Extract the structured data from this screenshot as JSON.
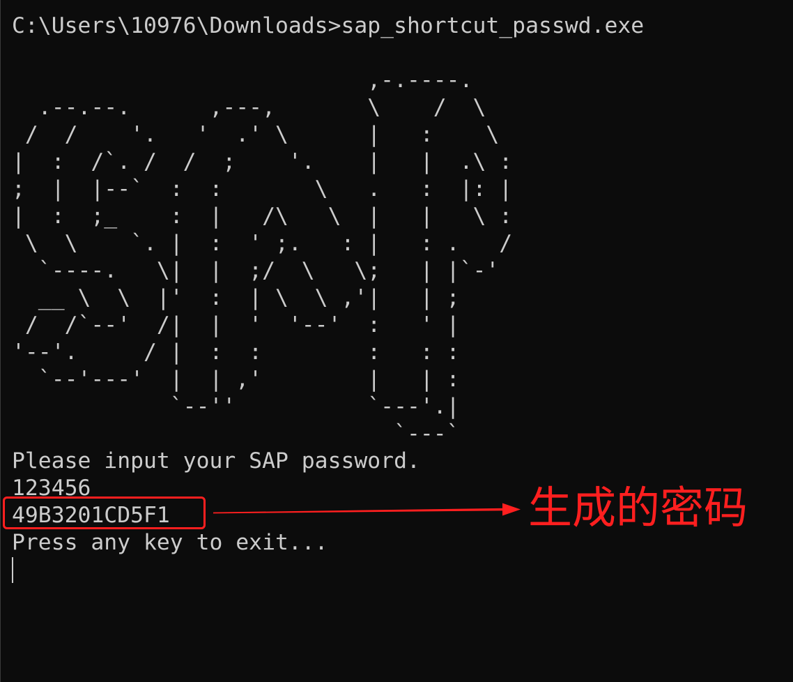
{
  "colors": {
    "terminal_background": "#0c0c0c",
    "terminal_text": "#cccccc",
    "annotation": "#ff1f1f"
  },
  "terminal": {
    "prompt": "C:\\Users\\10976\\Downloads>",
    "command": "sap_shortcut_passwd.exe",
    "banner_lines": [
      "                           ,-.----.",
      "  .--.--.      ,---,       \\    /  \\",
      " /  /    '.   '  .' \\      |   :    \\",
      "|  :  /`. /  /  ;    '.    |   |  .\\ :",
      ";  |  |--`  :  :       \\   .   :  |: |",
      "|  :  ;_    :  |   /\\   \\  |   |   \\ :",
      " \\  \\    `. |  :  ' ;.   : |   : .   /",
      "  `----.   \\|  |  ;/  \\   \\;   | |`-'",
      "  __ \\  \\  |'  :  | \\  \\ ,'|   | ;",
      " /  /`--'  /|  |  '  '--'  :   ' |",
      "'--'.     / |  :  :        :   : :",
      "  `--'---'  |  | ,'        |   | :",
      "            `--''          `---'.|",
      "                             `---`"
    ],
    "prompt_message": "Please input your SAP password.",
    "input_value": "123456",
    "generated_password": "49B3201CD5F1",
    "exit_message": "Press any key to exit..."
  },
  "annotation": {
    "label": "生成的密码"
  }
}
